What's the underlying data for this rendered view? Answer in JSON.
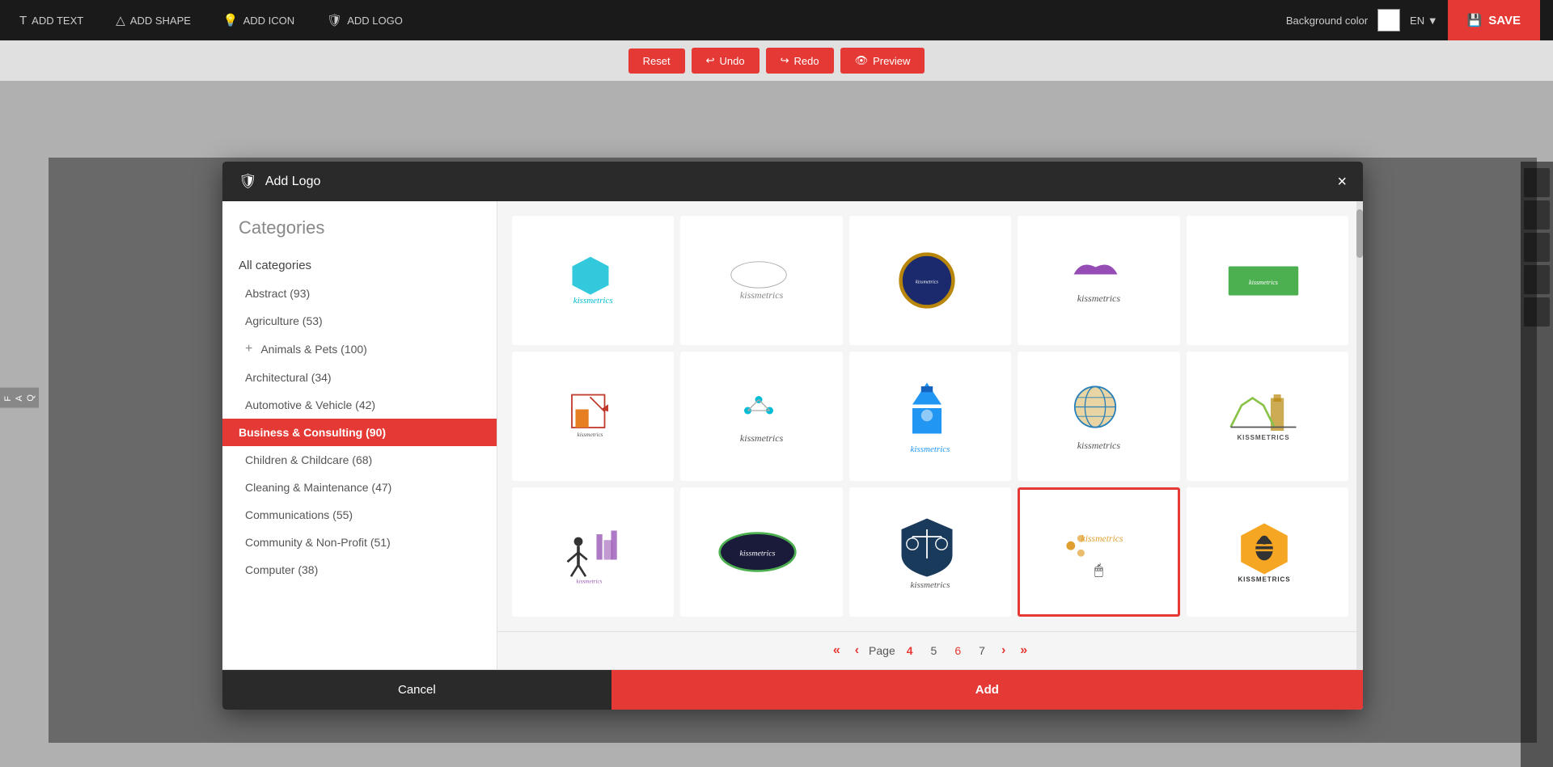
{
  "toolbar": {
    "add_text_label": "ADD TEXT",
    "add_shape_label": "ADD SHAPE",
    "add_icon_label": "ADD ICON",
    "add_logo_label": "ADD LOGO",
    "bg_color_label": "Background color",
    "lang": "EN",
    "save_label": "SAVE"
  },
  "action_bar": {
    "reset_label": "Reset",
    "undo_label": "Undo",
    "redo_label": "Redo",
    "preview_label": "Preview"
  },
  "modal": {
    "title": "Add Logo",
    "close_label": "×",
    "categories_title": "Categories",
    "cancel_label": "Cancel",
    "add_label": "Add"
  },
  "categories": [
    {
      "id": "all",
      "label": "All categories",
      "count": null
    },
    {
      "id": "abstract",
      "label": "Abstract (93)",
      "count": 93
    },
    {
      "id": "agriculture",
      "label": "Agriculture (53)",
      "count": 53
    },
    {
      "id": "animals",
      "label": "Animals & Pets (100)",
      "count": 100,
      "plus": true
    },
    {
      "id": "architectural",
      "label": "Architectural (34)",
      "count": 34
    },
    {
      "id": "automotive",
      "label": "Automotive & Vehicle (42)",
      "count": 42
    },
    {
      "id": "business",
      "label": "Business & Consulting (90)",
      "count": 90,
      "active": true
    },
    {
      "id": "children",
      "label": "Children & Childcare (68)",
      "count": 68
    },
    {
      "id": "cleaning",
      "label": "Cleaning & Maintenance (47)",
      "count": 47
    },
    {
      "id": "communications",
      "label": "Communications (55)",
      "count": 55
    },
    {
      "id": "community",
      "label": "Community & Non-Profit (51)",
      "count": 51
    },
    {
      "id": "computer",
      "label": "Computer (38)",
      "count": 38
    }
  ],
  "pagination": {
    "page_label": "Page",
    "pages": [
      "4",
      "5",
      "6",
      "7"
    ],
    "active_page": "4"
  },
  "logos": [
    {
      "id": 1,
      "row": 0,
      "col": 0,
      "type": "kissmetrics-cyan"
    },
    {
      "id": 2,
      "row": 0,
      "col": 1,
      "type": "kissmetrics-script"
    },
    {
      "id": 3,
      "row": 0,
      "col": 2,
      "type": "kissmetrics-badge"
    },
    {
      "id": 4,
      "row": 0,
      "col": 3,
      "type": "kissmetrics-purple"
    },
    {
      "id": 5,
      "row": 0,
      "col": 4,
      "type": "kissmetrics-rect-green"
    },
    {
      "id": 6,
      "row": 1,
      "col": 0,
      "type": "kissmetrics-house"
    },
    {
      "id": 7,
      "row": 1,
      "col": 1,
      "type": "kissmetrics-molecule"
    },
    {
      "id": 8,
      "row": 1,
      "col": 2,
      "type": "kissmetrics-church"
    },
    {
      "id": 9,
      "row": 1,
      "col": 3,
      "type": "kissmetrics-globe"
    },
    {
      "id": 10,
      "row": 1,
      "col": 4,
      "type": "kissmetrics-bridge"
    },
    {
      "id": 11,
      "row": 2,
      "col": 0,
      "type": "kissmetrics-city-man"
    },
    {
      "id": 12,
      "row": 2,
      "col": 1,
      "type": "kissmetrics-oval-dark"
    },
    {
      "id": 13,
      "row": 2,
      "col": 2,
      "type": "kissmetrics-shield-scale"
    },
    {
      "id": 14,
      "row": 2,
      "col": 3,
      "type": "kissmetrics-dots-selected",
      "selected": true
    },
    {
      "id": 15,
      "row": 2,
      "col": 4,
      "type": "kissmetrics-bee"
    }
  ]
}
